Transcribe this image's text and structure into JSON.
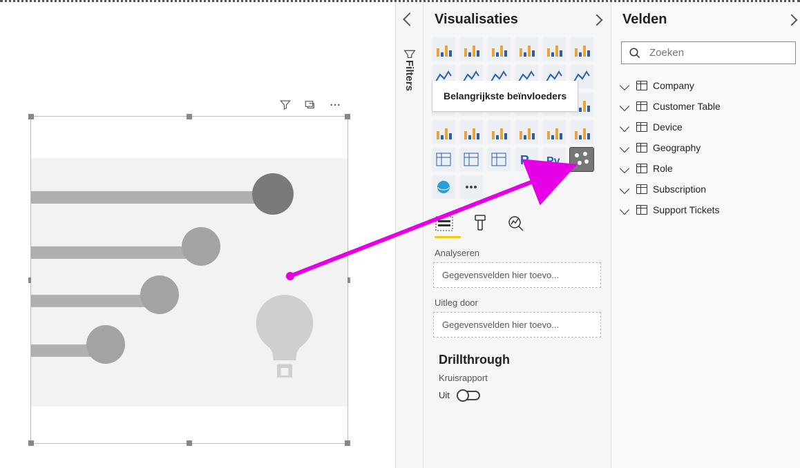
{
  "panes": {
    "visualizations_title": "Visualisaties",
    "fields_title": "Velden",
    "filters_label": "Filters"
  },
  "tooltip": "Belangrijkste beïnvloeders",
  "search": {
    "placeholder": "Zoeken"
  },
  "wells": {
    "analyze_label": "Analyseren",
    "explain_label": "Uitleg door",
    "placeholder": "Gegevensvelden hier toevo..."
  },
  "drillthrough": {
    "title": "Drillthrough",
    "cross_report_label": "Kruisrapport",
    "off_label": "Uit"
  },
  "fields": {
    "tables": [
      "Company",
      "Customer Table",
      "Device",
      "Geography",
      "Role",
      "Subscription",
      "Support Tickets"
    ]
  },
  "viz_gallery": [
    "stacked-bar",
    "stacked-column",
    "clustered-bar",
    "clustered-column",
    "100-bar",
    "100-column",
    "line",
    "area",
    "stacked-area",
    "line-col",
    "line-col2",
    "ribbon",
    "waterfall",
    "scatter",
    "pie",
    "donut",
    "treemap",
    "map",
    "filled-map",
    "funnel",
    "gauge",
    "card",
    "multi-card",
    "kpi",
    "slicer",
    "table",
    "matrix",
    "r-visual",
    "python-visual",
    "key-influencers",
    "arcgis",
    "more"
  ]
}
